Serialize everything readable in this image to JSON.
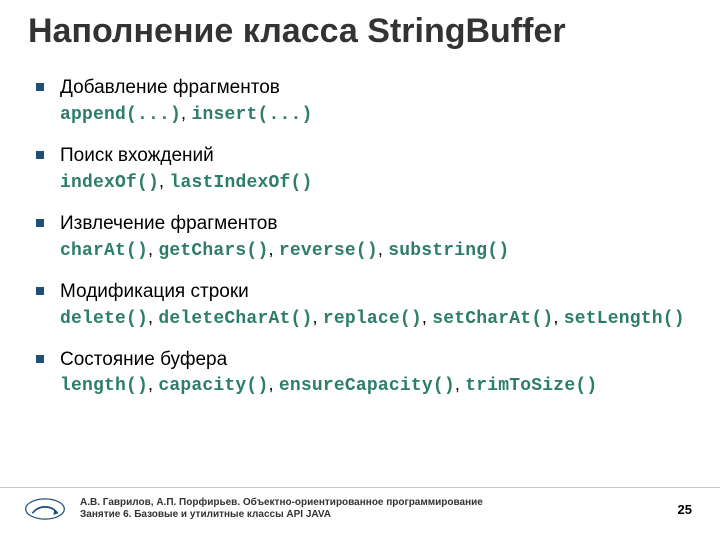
{
  "title": "Наполнение класса StringBuffer",
  "bullets": [
    {
      "label": "Добавление фрагментов",
      "methods": [
        "append(...)",
        "insert(...)"
      ]
    },
    {
      "label": "Поиск вхождений",
      "methods": [
        "indexOf()",
        "lastIndexOf()"
      ]
    },
    {
      "label": "Извлечение фрагментов",
      "methods": [
        "charAt()",
        "getChars()",
        "reverse()",
        "substring()"
      ]
    },
    {
      "label": "Модификация строки",
      "methods": [
        "delete()",
        "deleteCharAt()",
        "replace()",
        "setCharAt()",
        "setLength()"
      ]
    },
    {
      "label": "Состояние буфера",
      "methods": [
        "length()",
        "capacity()",
        "ensureCapacity()",
        "trimToSize()"
      ]
    }
  ],
  "footer": {
    "line1": "А.В. Гаврилов, А.П. Порфирьев. Объектно-ориентированное программирование",
    "line2": "Занятие 6. Базовые и утилитные классы API JAVA"
  },
  "page_number": "25",
  "colors": {
    "code": "#2e7d6b",
    "bullet": "#1f4e79",
    "logo_stroke": "#1f4e79"
  }
}
